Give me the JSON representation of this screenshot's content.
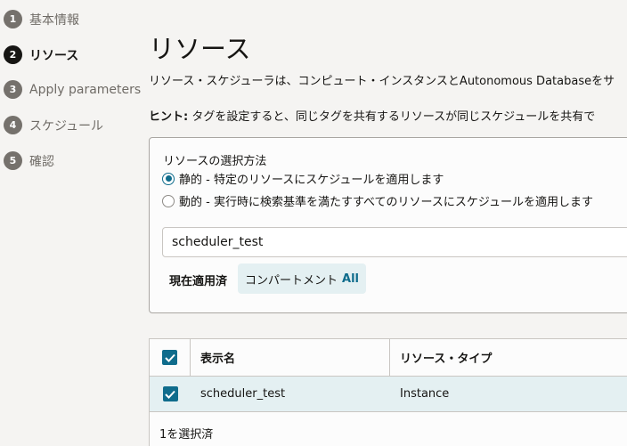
{
  "steps": [
    {
      "num": "1",
      "label": "基本情報"
    },
    {
      "num": "2",
      "label": "リソース"
    },
    {
      "num": "3",
      "label": "Apply parameters"
    },
    {
      "num": "4",
      "label": "スケジュール"
    },
    {
      "num": "5",
      "label": "確認"
    }
  ],
  "main": {
    "title": "リソース",
    "description": "リソース・スケジューラは、コンピュート・インスタンスとAutonomous Databaseをサ",
    "hint_label": "ヒント:",
    "hint_text": " タグを設定すると、同じタグを共有するリソースが同じスケジュールを共有で"
  },
  "selection": {
    "legend": "リソースの選択方法",
    "options": [
      {
        "label": "静的 - 特定のリソースにスケジュールを適用します",
        "checked": true
      },
      {
        "label": "動的 - 実行時に検索基準を満たすすべてのリソースにスケジュールを適用します",
        "checked": false
      }
    ],
    "tag_value": "scheduler_test",
    "applied_label": "現在適用済",
    "chip_text": "コンパートメント",
    "chip_value": "All"
  },
  "table": {
    "columns": [
      "表示名",
      "リソース・タイプ"
    ],
    "rows": [
      {
        "name": "scheduler_test",
        "type": "Instance"
      }
    ],
    "footer": "1を選択済"
  }
}
